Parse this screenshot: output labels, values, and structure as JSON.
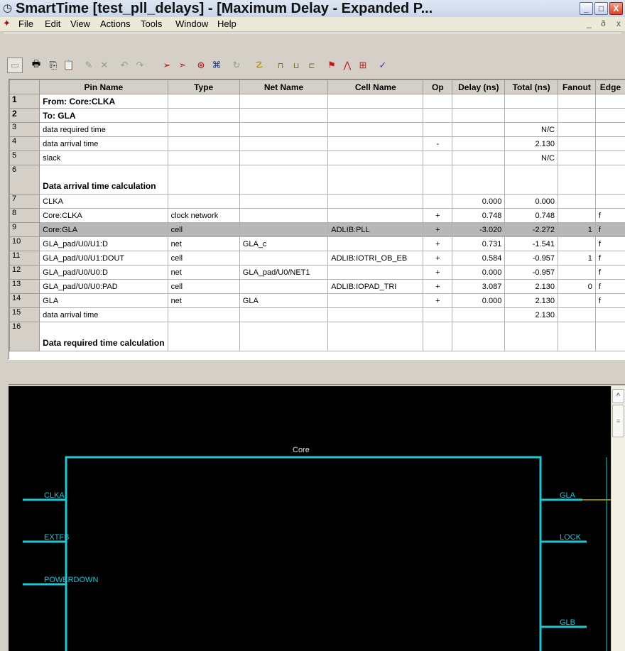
{
  "window": {
    "title": "SmartTime [test_pll_delays] - [Maximum Delay - Expanded P...",
    "controls": {
      "minimize": "_",
      "restore": "□",
      "close": "X"
    }
  },
  "menu": {
    "items": [
      "File",
      "Edit",
      "View",
      "Actions",
      "Tools",
      "Window",
      "Help"
    ],
    "mdi_controls": {
      "minimize": "_",
      "restore": "ð",
      "close": "x"
    }
  },
  "table": {
    "columns": [
      "Pin Name",
      "Type",
      "Net Name",
      "Cell Name",
      "Op",
      "Delay (ns)",
      "Total (ns)",
      "Fanout",
      "Edge"
    ],
    "rows": [
      {
        "n": "1",
        "pin": "From: Core:CLKA",
        "type": "",
        "net": "",
        "cell": "",
        "op": "",
        "delay": "",
        "total": "",
        "fanout": "",
        "edge": ""
      },
      {
        "n": "2",
        "pin": "To: GLA",
        "type": "",
        "net": "",
        "cell": "",
        "op": "",
        "delay": "",
        "total": "",
        "fanout": "",
        "edge": ""
      },
      {
        "n": "3",
        "pin": "data required time",
        "type": "",
        "net": "",
        "cell": "",
        "op": "",
        "delay": "",
        "total": "N/C",
        "fanout": "",
        "edge": ""
      },
      {
        "n": "4",
        "pin": "data arrival time",
        "type": "",
        "net": "",
        "cell": "",
        "op": "-",
        "delay": "",
        "total": "2.130",
        "fanout": "",
        "edge": ""
      },
      {
        "n": "5",
        "pin": "slack",
        "type": "",
        "net": "",
        "cell": "",
        "op": "",
        "delay": "",
        "total": "N/C",
        "fanout": "",
        "edge": ""
      },
      {
        "n": "6",
        "pin": "Data arrival time calculation",
        "type": "",
        "net": "",
        "cell": "",
        "op": "",
        "delay": "",
        "total": "",
        "fanout": "",
        "edge": ""
      },
      {
        "n": "7",
        "pin": "CLKA",
        "type": "",
        "net": "",
        "cell": "",
        "op": "",
        "delay": "0.000",
        "total": "0.000",
        "fanout": "",
        "edge": ""
      },
      {
        "n": "8",
        "pin": "Core:CLKA",
        "type": "clock network",
        "net": "",
        "cell": "",
        "op": "+",
        "delay": "0.748",
        "total": "0.748",
        "fanout": "",
        "edge": "f"
      },
      {
        "n": "9",
        "pin": "Core:GLA",
        "type": "cell",
        "net": "",
        "cell": "ADLIB:PLL",
        "op": "+",
        "delay": "-3.020",
        "total": "-2.272",
        "fanout": "1",
        "edge": "f"
      },
      {
        "n": "10",
        "pin": "GLA_pad/U0/U1:D",
        "type": "net",
        "net": "GLA_c",
        "cell": "",
        "op": "+",
        "delay": "0.731",
        "total": "-1.541",
        "fanout": "",
        "edge": "f"
      },
      {
        "n": "11",
        "pin": "GLA_pad/U0/U1:DOUT",
        "type": "cell",
        "net": "",
        "cell": "ADLIB:IOTRI_OB_EB",
        "op": "+",
        "delay": "0.584",
        "total": "-0.957",
        "fanout": "1",
        "edge": "f"
      },
      {
        "n": "12",
        "pin": "GLA_pad/U0/U0:D",
        "type": "net",
        "net": "GLA_pad/U0/NET1",
        "cell": "",
        "op": "+",
        "delay": "0.000",
        "total": "-0.957",
        "fanout": "",
        "edge": "f"
      },
      {
        "n": "13",
        "pin": "GLA_pad/U0/U0:PAD",
        "type": "cell",
        "net": "",
        "cell": "ADLIB:IOPAD_TRI",
        "op": "+",
        "delay": "3.087",
        "total": "2.130",
        "fanout": "0",
        "edge": "f"
      },
      {
        "n": "14",
        "pin": "GLA",
        "type": "net",
        "net": "GLA",
        "cell": "",
        "op": "+",
        "delay": "0.000",
        "total": "2.130",
        "fanout": "",
        "edge": "f"
      },
      {
        "n": "15",
        "pin": "data arrival time",
        "type": "",
        "net": "",
        "cell": "",
        "op": "",
        "delay": "",
        "total": "2.130",
        "fanout": "",
        "edge": ""
      },
      {
        "n": "16",
        "pin": "Data required time calculation",
        "type": "",
        "net": "",
        "cell": "",
        "op": "",
        "delay": "",
        "total": "",
        "fanout": "",
        "edge": ""
      }
    ],
    "selected_row": "9"
  },
  "schematic": {
    "block_label": "Core",
    "inputs": [
      "CLKA",
      "EXTFB",
      "POWERDOWN"
    ],
    "outputs": [
      "GLA",
      "LOCK",
      "GLB"
    ],
    "colors": {
      "wire": "#1fc6d6",
      "highlight": "#c8b400",
      "text": "#1fc6d6",
      "background": "#000000"
    }
  },
  "scrollbar": {
    "up_arrow": "^",
    "thumb_grip": "≡"
  }
}
